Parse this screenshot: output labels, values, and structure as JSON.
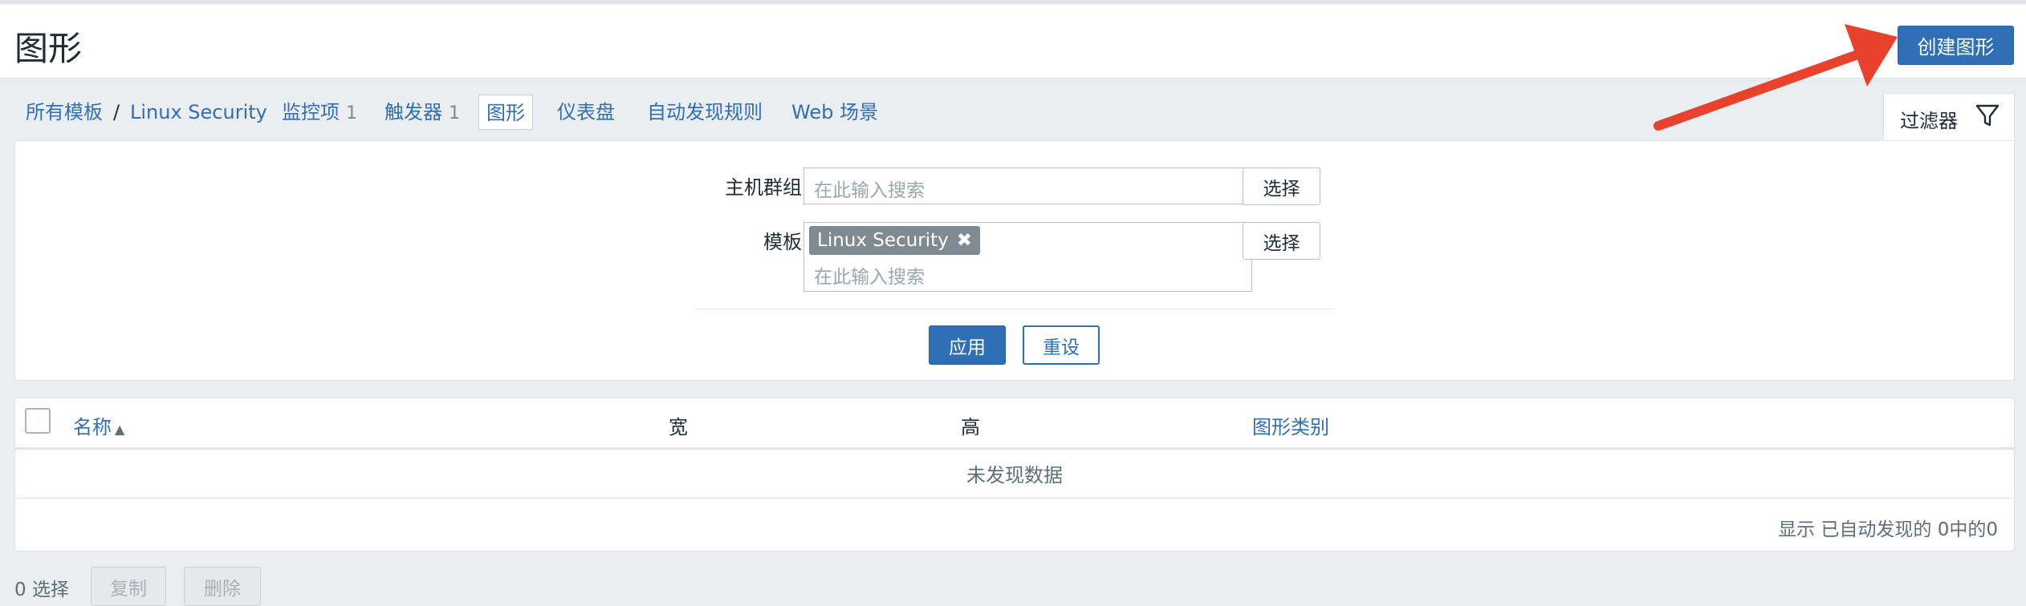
{
  "header": {
    "title": "图形",
    "create_button": "创建图形"
  },
  "nav": {
    "all_templates": "所有模板",
    "separator": "/",
    "template_name": "Linux Security",
    "items": "监控项",
    "items_count": "1",
    "triggers": "触发器",
    "triggers_count": "1",
    "graphs": "图形",
    "dashboards": "仪表盘",
    "discovery_rules": "自动发现规则",
    "web_scenarios": "Web 场景"
  },
  "filter": {
    "tab_label": "过滤器",
    "host_group_label": "主机群组",
    "host_group_placeholder": "在此输入搜索",
    "template_label": "模板",
    "template_tag": "Linux Security",
    "template_placeholder": "在此输入搜索",
    "select_button": "选择",
    "apply_button": "应用",
    "reset_button": "重设"
  },
  "table": {
    "columns": [
      "名称",
      "宽",
      "高",
      "图形类别"
    ],
    "sort_indicator": "▲",
    "no_data": "未发现数据",
    "footer": "显示 已自动发现的 0中的0"
  },
  "bottom": {
    "selected_count": "0 选择",
    "copy_button": "复制",
    "delete_button": "删除"
  },
  "colors": {
    "accent": "#2f6fb5",
    "annotation_arrow": "#e8412c"
  },
  "icons": {
    "filter": "funnel-icon",
    "remove_tag": "close-icon"
  }
}
